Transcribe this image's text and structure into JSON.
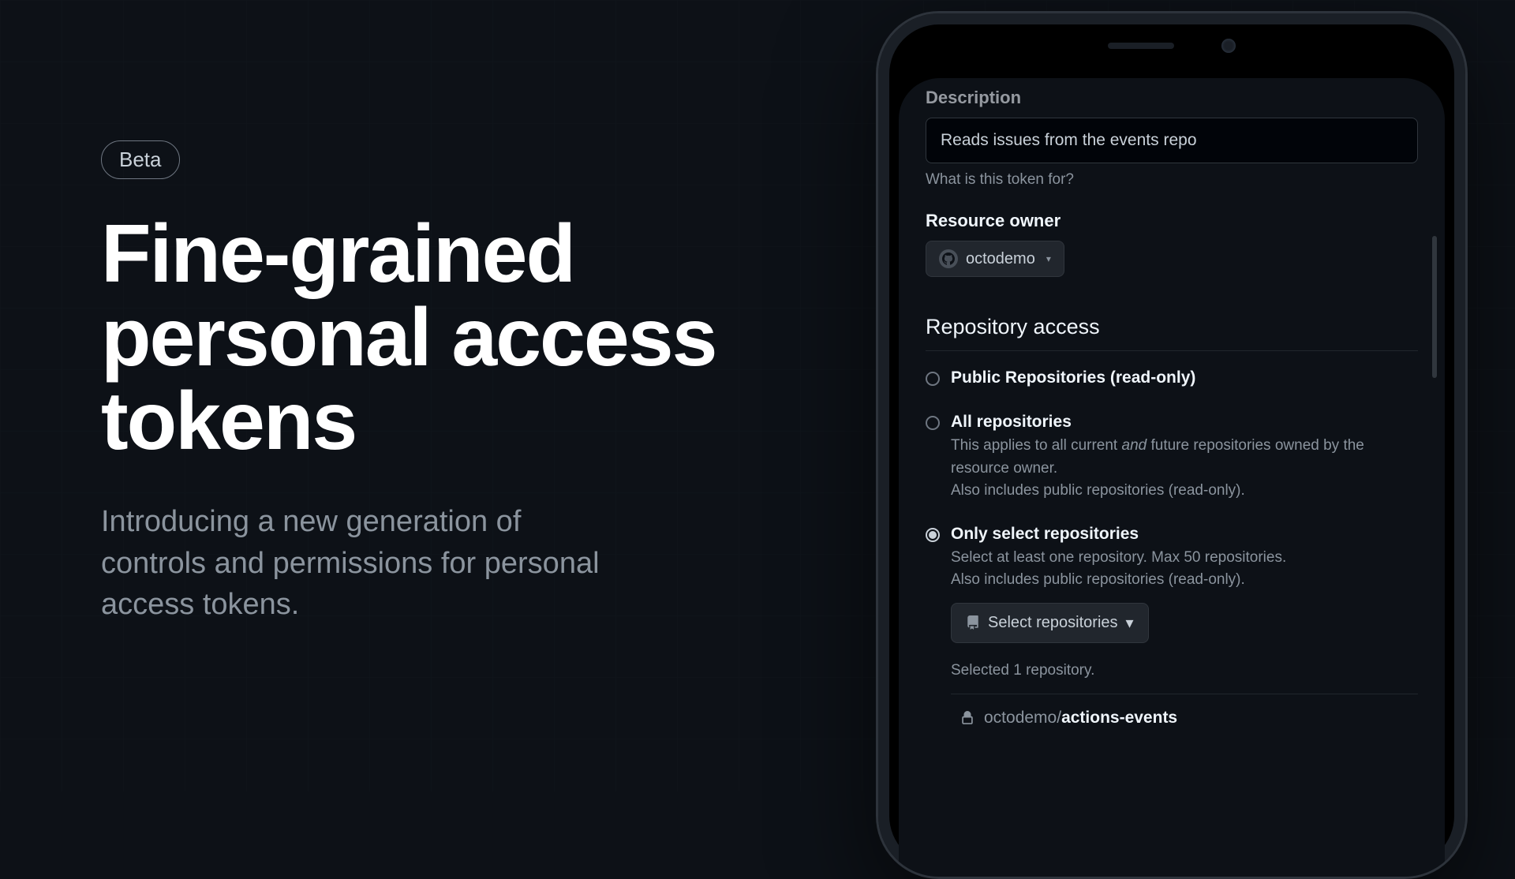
{
  "hero": {
    "badge": "Beta",
    "title": "Fine-grained personal access tokens",
    "subtitle": "Introducing a new generation of controls and permissions for personal access tokens."
  },
  "form": {
    "description_label": "Description",
    "description_value": "Reads issues from the events repo",
    "description_helper": "What is this token for?",
    "resource_owner_label": "Resource owner",
    "resource_owner_value": "octodemo",
    "repo_access_heading": "Repository access",
    "options": {
      "public": {
        "title": "Public Repositories (read-only)",
        "selected": false
      },
      "all": {
        "title": "All repositories",
        "desc_prefix": "This applies to all current ",
        "desc_em": "and",
        "desc_suffix": " future repositories owned by the resource owner.",
        "desc_line2": "Also includes public repositories (read-only).",
        "selected": false
      },
      "select": {
        "title": "Only select repositories",
        "desc_line1": "Select at least one repository. Max 50 repositories.",
        "desc_line2": "Also includes public repositories (read-only).",
        "selected": true
      }
    },
    "select_repos_button": "Select repositories",
    "selected_count_text": "Selected 1 repository.",
    "selected_repo": {
      "owner": "octodemo/",
      "name": "actions-events"
    }
  }
}
